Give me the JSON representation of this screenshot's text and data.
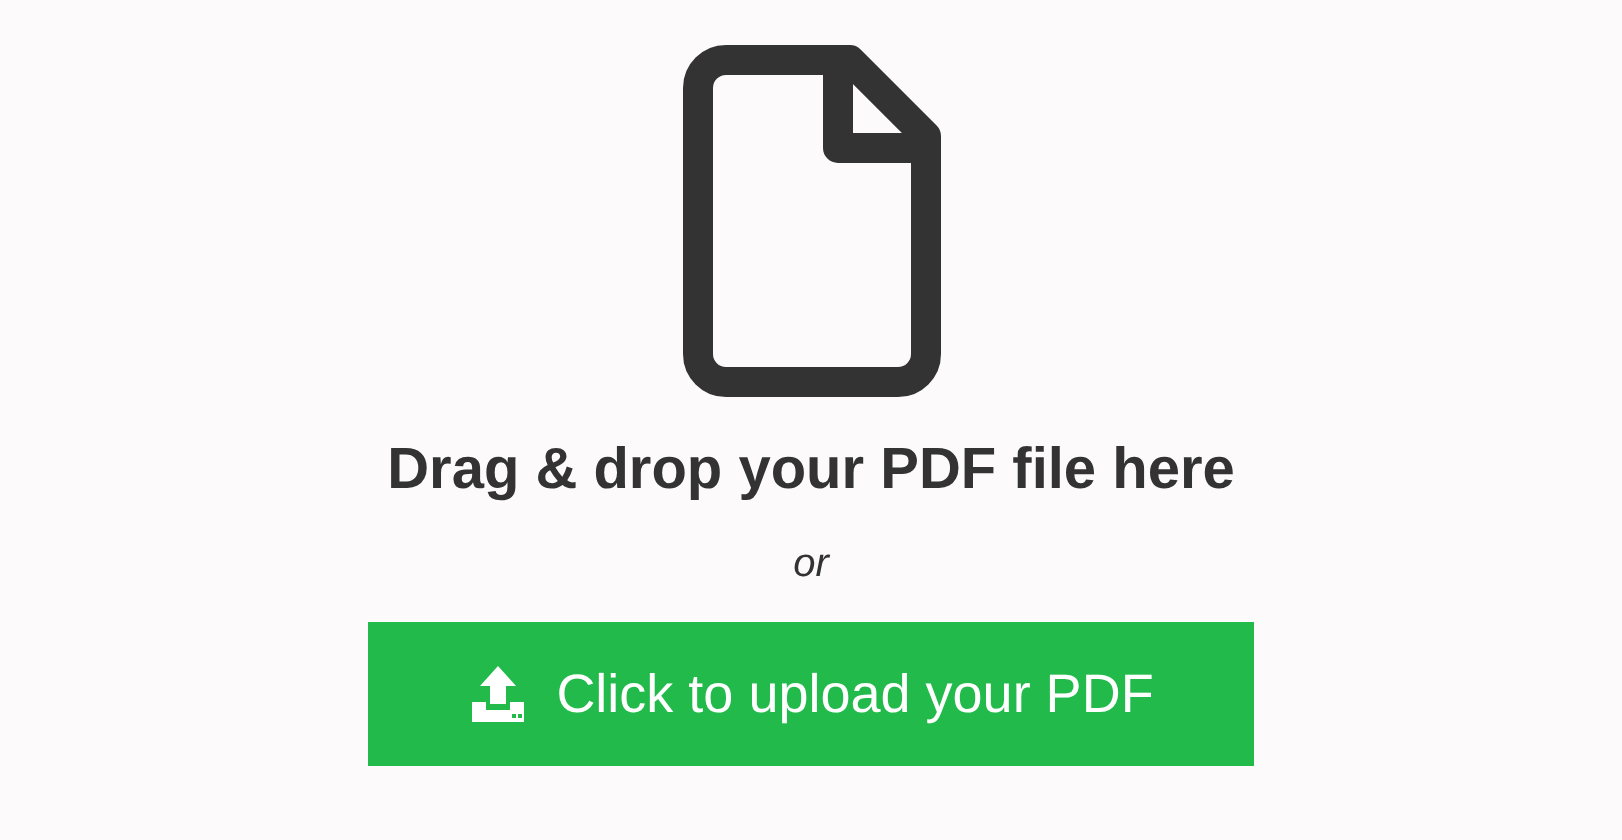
{
  "heading": "Drag & drop your PDF file here",
  "separator": "or",
  "upload_button": {
    "label": "Click to upload your PDF"
  }
}
